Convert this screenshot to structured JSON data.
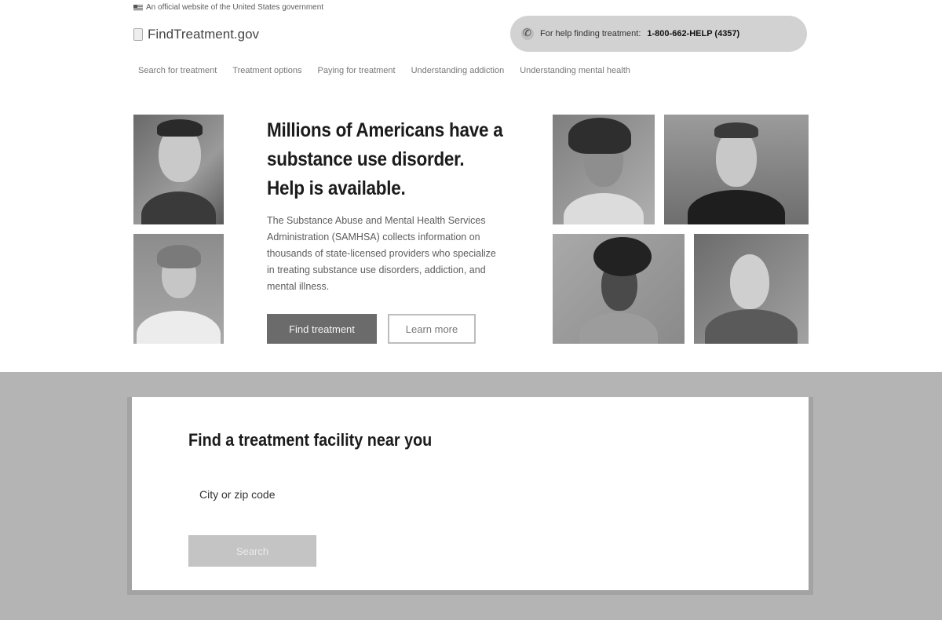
{
  "gov_banner": {
    "text": "An official website of the United States government"
  },
  "header": {
    "logo_text": "FindTreatment.gov",
    "helpline": {
      "prefix": "For help finding treatment:",
      "number": "1-800-662-HELP (4357)"
    }
  },
  "nav": {
    "items": [
      {
        "label": "Search for treatment"
      },
      {
        "label": "Treatment options"
      },
      {
        "label": "Paying for treatment"
      },
      {
        "label": "Understanding addiction"
      },
      {
        "label": "Understanding mental health"
      }
    ]
  },
  "hero": {
    "title_line1": "Millions of Americans have a",
    "title_line2": "substance use disorder.",
    "title_line3": "Help is available.",
    "description": "The Substance Abuse and Mental Health Services Administration (SAMHSA) collects information on thousands of state-licensed providers who specialize in treating substance use disorders, addiction, and mental illness.",
    "primary_button": "Find treatment",
    "secondary_button": "Learn more"
  },
  "search": {
    "heading": "Find a treatment facility near you",
    "location_label": "City or zip code",
    "button_label": "Search"
  },
  "colors": {
    "band_background": "#b4b4b4",
    "primary_button": "#6b6b6b",
    "helpline_pill": "#d2d2d2"
  }
}
